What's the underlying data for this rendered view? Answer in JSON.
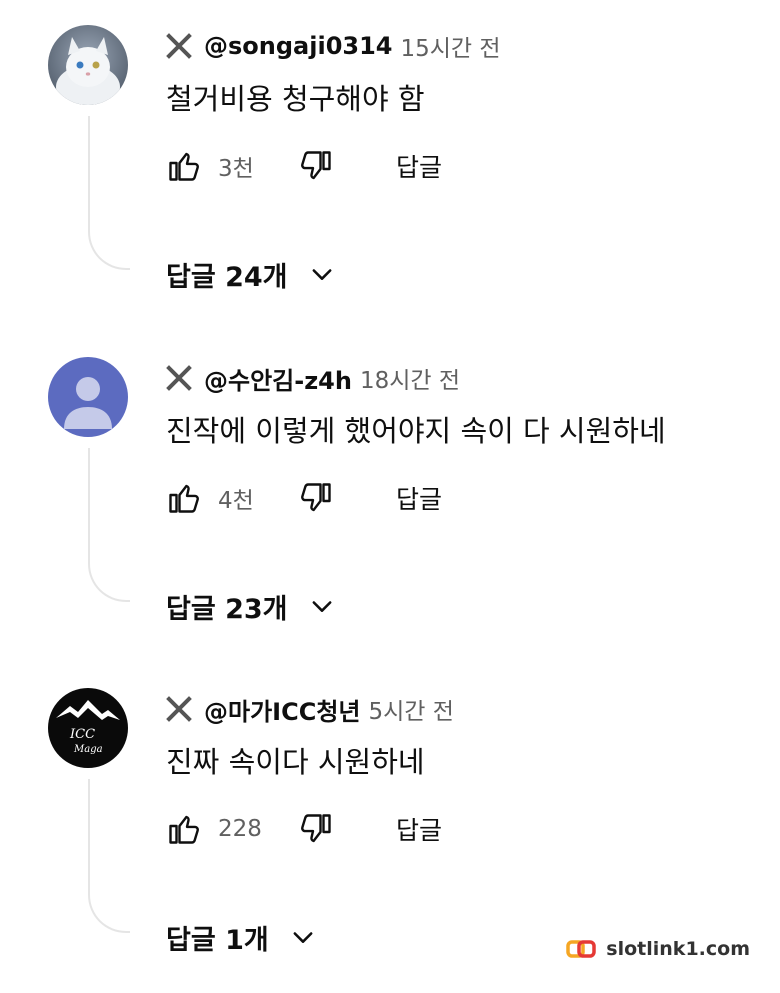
{
  "comments": [
    {
      "author": "@songaji0314",
      "time": "15시간 전",
      "text": "철거비용 청구해야 함",
      "likes": "3천",
      "reply_label": "답글",
      "replies_label": "답글 24개",
      "avatar": "white-cat-photo"
    },
    {
      "author": "@수안김-z4h",
      "time": "18시간 전",
      "text": "진작에 이렇게 했어야지 속이 다 시원하네",
      "likes": "4천",
      "reply_label": "답글",
      "replies_label": "답글 23개",
      "avatar": "default-person-avatar",
      "avatar_color": "#5c6bc0"
    },
    {
      "author": "@마가ICC청년",
      "time": "5시간 전",
      "text": "진짜 속이다 시원하네",
      "likes": "228",
      "reply_label": "답글",
      "replies_label": "답글 1개",
      "avatar": "mountain-logo",
      "avatar_text": "ICC Maga"
    }
  ],
  "watermark": {
    "text": "slotlink1.com",
    "icon": "chain-link-icon",
    "colors": [
      "#f5a623",
      "#e53935"
    ]
  }
}
